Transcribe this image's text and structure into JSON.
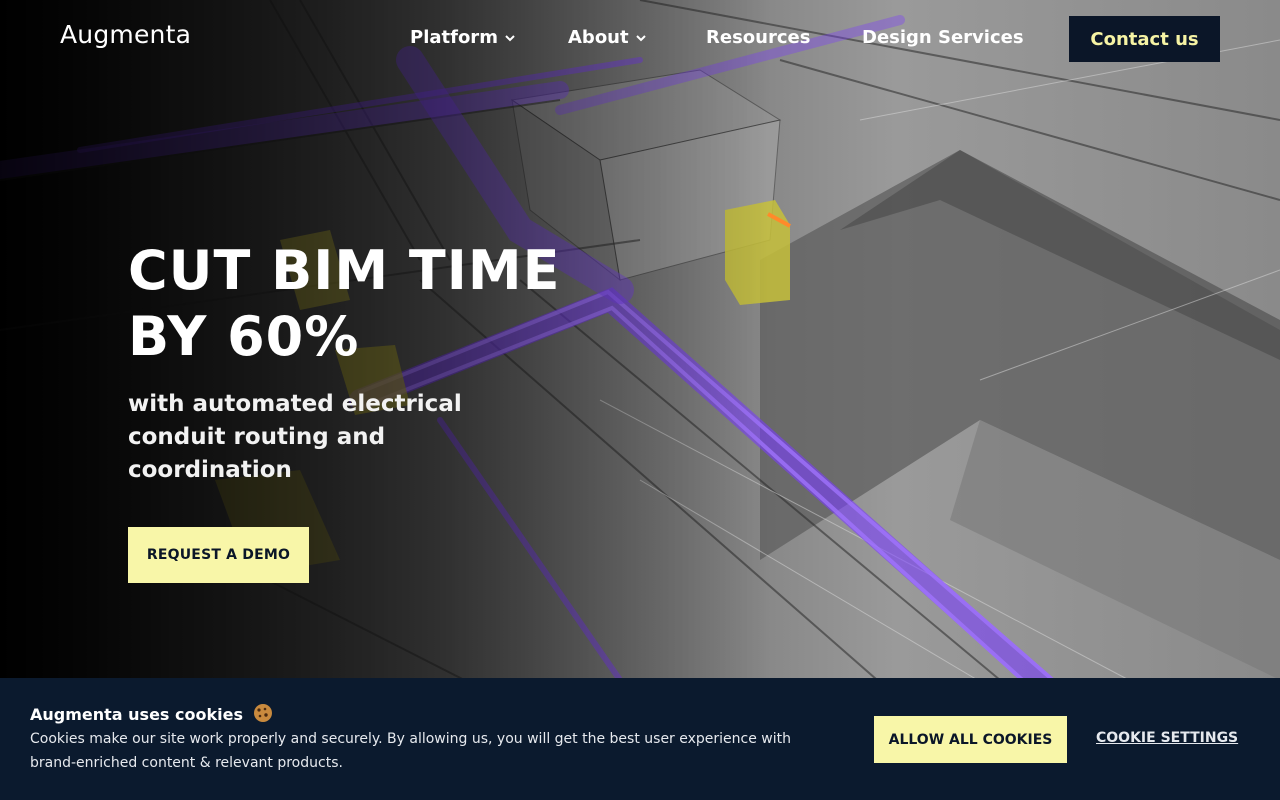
{
  "brand": {
    "logo_text": "Augmenta"
  },
  "nav": {
    "items": [
      {
        "label": "Platform",
        "has_dropdown": true
      },
      {
        "label": "About",
        "has_dropdown": true
      },
      {
        "label": "Resources",
        "has_dropdown": false
      },
      {
        "label": "Design Services",
        "has_dropdown": false
      }
    ],
    "contact_label": "Contact us"
  },
  "hero": {
    "title_line1": "CUT BIM TIME",
    "title_line2": "BY 60%",
    "subtitle": "with automated electrical conduit routing and coordination",
    "cta_label": "REQUEST A DEMO"
  },
  "cookie_banner": {
    "title": "Augmenta uses cookies",
    "icon": "cookie-icon",
    "text": "Cookies make our site work properly and securely. By allowing us, you will get the best user experience with brand-enriched content & relevant products.",
    "allow_label": "ALLOW ALL COOKIES",
    "settings_label": "COOKIE SETTINGS"
  },
  "colors": {
    "accent_yellow": "#f8f6a8",
    "navy": "#0b1628",
    "conduit_purple": "#7b3cff"
  }
}
